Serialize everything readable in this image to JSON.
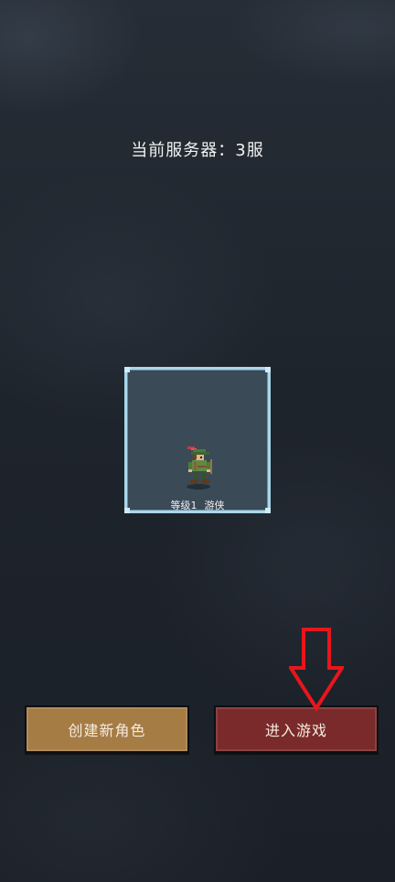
{
  "server": {
    "label": "当前服务器：3服"
  },
  "character": {
    "level": "等级1",
    "class": "游侠"
  },
  "buttons": {
    "create": "创建新角色",
    "enter": "进入游戏"
  },
  "icons": {
    "character_sprite": "ranger-sprite",
    "hint_arrow": "down-arrow-icon"
  },
  "colors": {
    "create_button": "#a67c45",
    "enter_button": "#7a2a2a",
    "card_border": "#a9d6ea",
    "arrow": "#e8161b"
  }
}
